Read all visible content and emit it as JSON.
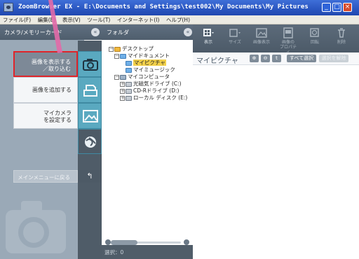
{
  "window": {
    "title": "ZoomBrowser EX - E:\\Documents and Settings\\test002\\My Documents\\My Pictures",
    "min_label": "_",
    "max_label": "□",
    "close_label": "×"
  },
  "menubar": [
    "ファイル(F)",
    "編集(E)",
    "表示(V)",
    "ツール(T)",
    "インターネット(I)",
    "ヘルプ(H)"
  ],
  "left_panel": {
    "header": "カメラ/メモリーカード",
    "collapse_label": "«",
    "buttons": [
      {
        "label_line1": "画像を表示する",
        "label_line2": "／取り込む",
        "icon": "camera-icon",
        "active": true
      },
      {
        "label_line1": "画像を追加する",
        "label_line2": "",
        "icon": "print-icon",
        "active": false
      },
      {
        "label_line1": "マイカメラ",
        "label_line2": "を設定する",
        "icon": "settings-image-icon",
        "active": false
      },
      {
        "label_line1": "",
        "label_line2": "",
        "icon": "globe-icon",
        "active": false
      }
    ],
    "back_button": "メインメニューに戻る",
    "back_icon": "↰"
  },
  "folder_panel": {
    "header": "フォルダ",
    "collapse_label": "«",
    "tree": [
      {
        "indent": 0,
        "toggle": "－",
        "icon": "desk",
        "label": "デスクトップ",
        "selected": false
      },
      {
        "indent": 1,
        "toggle": "－",
        "icon": "doc",
        "label": "マイドキュメント",
        "selected": false
      },
      {
        "indent": 2,
        "toggle": "",
        "icon": "doc",
        "label": "マイピクチャ",
        "selected": true
      },
      {
        "indent": 2,
        "toggle": "",
        "icon": "doc",
        "label": "マイミュージック",
        "selected": false
      },
      {
        "indent": 1,
        "toggle": "－",
        "icon": "pc",
        "label": "マイコンピュータ",
        "selected": false
      },
      {
        "indent": 2,
        "toggle": "＋",
        "icon": "drv",
        "label": "光磁気ドライブ (C:)",
        "selected": false
      },
      {
        "indent": 2,
        "toggle": "＋",
        "icon": "drv",
        "label": "CD-Rドライブ (D:)",
        "selected": false
      },
      {
        "indent": 2,
        "toggle": "＋",
        "icon": "drv",
        "label": "ローカル ディスク (E:)",
        "selected": false
      }
    ],
    "status": "選択：0"
  },
  "toolbar": {
    "buttons": [
      {
        "label": "表示",
        "icon": "view-icon",
        "enabled": true
      },
      {
        "label": "サイズ",
        "icon": "size-icon",
        "enabled": false
      },
      {
        "label": "画像表示",
        "icon": "image-view-icon",
        "enabled": false
      },
      {
        "label": "画像の\nプロパティ",
        "icon": "properties-icon",
        "enabled": false
      },
      {
        "label": "回転",
        "icon": "rotate-icon",
        "enabled": false
      },
      {
        "label": "削除",
        "icon": "delete-icon",
        "enabled": false
      }
    ]
  },
  "content": {
    "title": "マイピクチャ",
    "zoom_in": "⊕",
    "zoom_out": "⊖",
    "up": "t",
    "select_all": "すべて選択",
    "deselect": "選択を解除"
  },
  "colors": {
    "accent_red": "#e0242a",
    "callout_pink": "#e26aa9",
    "tab_blue": "#5aa9c0",
    "selection_yellow": "#f2d04a"
  }
}
